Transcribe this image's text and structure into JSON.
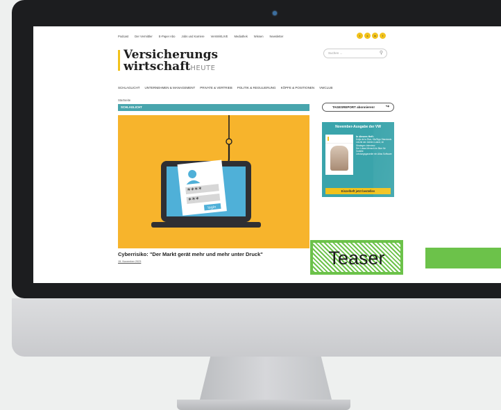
{
  "site": {
    "top_nav": [
      "Podcast",
      "Der Vermittler",
      "E-Paper Abo",
      "Jobs und Karriere",
      "VersWirtLIVE",
      "Mediathek",
      "Wissen",
      "Newsletter"
    ],
    "social": [
      "t",
      "x",
      "in",
      "f"
    ],
    "logo": {
      "line1": "Versicherungs",
      "line2": "wirtschaft",
      "suffix": "HEUTE"
    },
    "search": {
      "placeholder": "Suchen ..."
    },
    "main_nav": [
      "SCHLAGLICHT",
      "UNTERNEHMEN & MANAGEMENT",
      "PRIVATE & VERTRIEB",
      "POLITIK & REGULIERUNG",
      "KÖPFE & POSITIONEN",
      "VWCLUB"
    ],
    "breadcrumb": "Startseite",
    "section_label": "SCHLAGLICHT",
    "article": {
      "headline": "Cyberrisiko: \"Der Markt gerät mehr und mehr unter Druck\"",
      "date": "15. November 2023",
      "image_login_label": "login",
      "image_password_mask": "****",
      "image_user_mask": "***"
    },
    "sidebar": {
      "subscribe_label": "TAGESREPORT abonnieren!",
      "promo_title": "November-Ausgabe der VW",
      "promo_heading": "In diesem Heft:",
      "promo_lines": [
        "Kolja de la Riva, Kfz/Sign Standards",
        "Liechti der Zahlen Lokrot, im Strategen Interview",
        "Der Lukas Mensch im Blue für Vorteile",
        "Leistungsgarantie ein Atlas Software"
      ],
      "promo_cta": "Einzelheft jetzt bestellen"
    }
  },
  "annotation": {
    "label": "Teaser"
  },
  "colors": {
    "accent_yellow": "#f2c21b",
    "teal": "#48a5ad",
    "hero_bg": "#f7b42c",
    "teaser_green": "#6cc24a"
  }
}
